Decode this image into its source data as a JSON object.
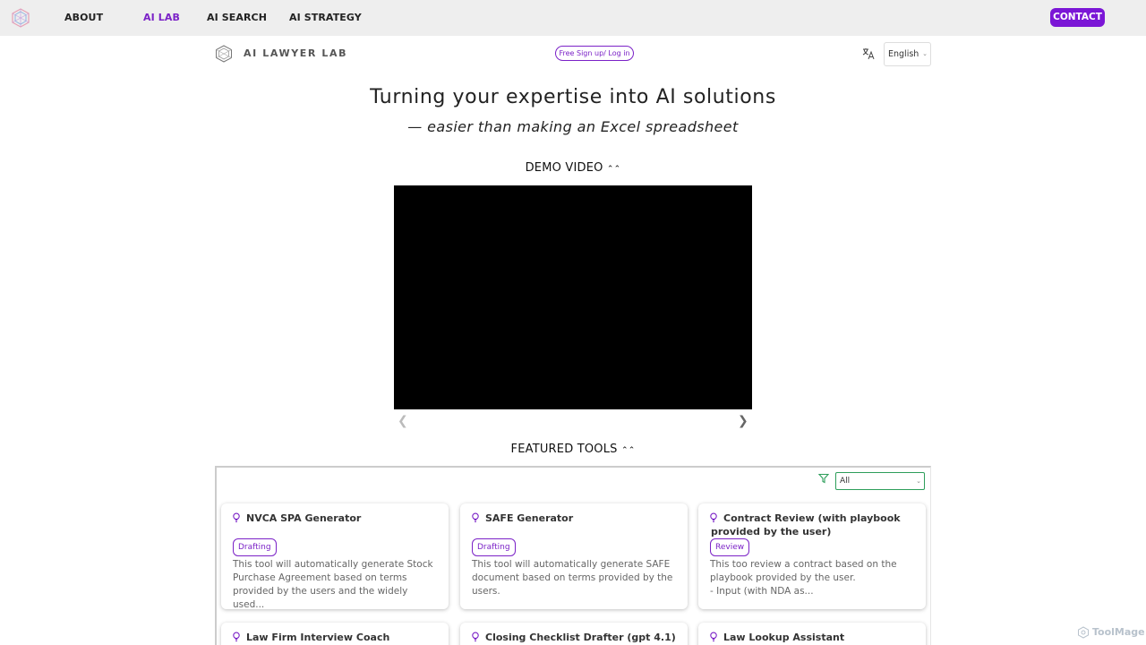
{
  "topnav": {
    "links": [
      "ABOUT",
      "AI LAB",
      "AI SEARCH",
      "AI STRATEGY"
    ],
    "active": "AI LAB",
    "contact_label": "CONTACT"
  },
  "header": {
    "brand": "AI LAWYER LAB",
    "signup_label": "Free Sign up/ Log in",
    "language": "English"
  },
  "hero": {
    "title": "Turning your expertise into AI solutions",
    "subtitle": "— easier than making an Excel spreadsheet"
  },
  "demo": {
    "heading": "DEMO VIDEO",
    "chevron": "«"
  },
  "featured": {
    "heading": "FEATURED TOOLS",
    "filter_value": "All",
    "cards": [
      {
        "title": "NVCA SPA Generator",
        "tag": "Drafting",
        "desc": "This tool will automatically generate Stock Purchase Agreement based on terms provided by the users and the widely used..."
      },
      {
        "title": "SAFE Generator",
        "tag": "Drafting",
        "desc": "This tool will automatically generate SAFE document based on terms provided by the users."
      },
      {
        "title": "Contract Review (with playbook provided by the user)",
        "tag": "Review",
        "desc": "This too review a contract based on the playbook provided by the user.\n- Input (with NDA as..."
      },
      {
        "title": "Law Firm Interview Coach"
      },
      {
        "title": "Closing Checklist Drafter (gpt 4.1)"
      },
      {
        "title": "Law Lookup Assistant (Multilingual)"
      }
    ]
  },
  "watermark": "ToolMage",
  "colors": {
    "accent": "#7b22c7",
    "contact_bg": "#7b16d6",
    "filter_border": "#2e9e5b"
  }
}
